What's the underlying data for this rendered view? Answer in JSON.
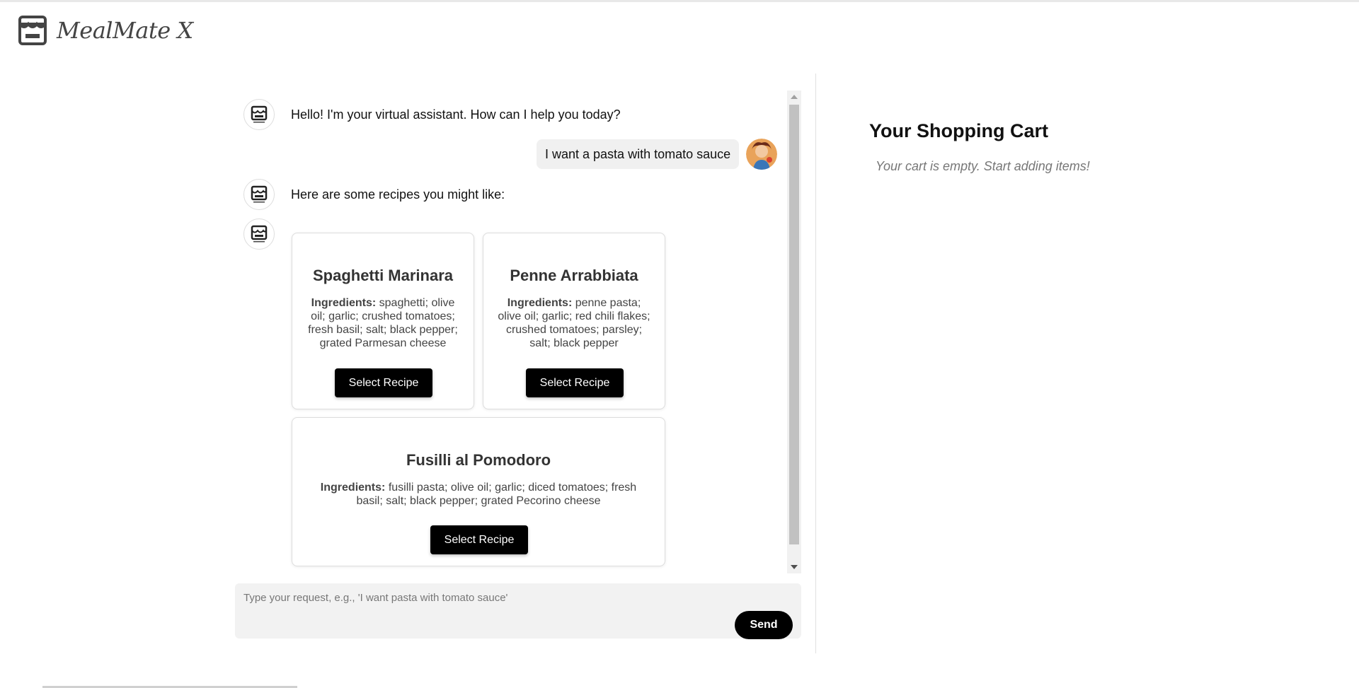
{
  "app": {
    "brand_name": "MealMate X",
    "logo_icon": "storefront-icon"
  },
  "chat": {
    "messages": [
      {
        "from": "bot",
        "text": "Hello! I'm your virtual assistant. How can I help you today?"
      },
      {
        "from": "user",
        "text": "I want a pasta with tomato sauce"
      },
      {
        "from": "bot",
        "text": "Here are some recipes you might like:"
      }
    ],
    "recipes": [
      {
        "title": "Spaghetti Marinara",
        "ingredients_label": "Ingredients:",
        "ingredients": "spaghetti; olive oil; garlic; crushed tomatoes; fresh basil; salt; black pepper; grated Parmesan cheese",
        "button_label": "Select Recipe"
      },
      {
        "title": "Penne Arrabbiata",
        "ingredients_label": "Ingredients:",
        "ingredients": "penne pasta; olive oil; garlic; red chili flakes; crushed tomatoes; parsley; salt; black pepper",
        "button_label": "Select Recipe"
      },
      {
        "title": "Fusilli al Pomodoro",
        "ingredients_label": "Ingredients:",
        "ingredients": "fusilli pasta; olive oil; garlic; diced tomatoes; fresh basil; salt; black pepper; grated Pecorino cheese",
        "button_label": "Select Recipe"
      }
    ]
  },
  "input": {
    "placeholder": "Type your request, e.g., 'I want pasta with tomato sauce'",
    "value": "",
    "send_label": "Send"
  },
  "cart": {
    "title": "Your Shopping Cart",
    "empty_message": "Your cart is empty. Start adding items!"
  },
  "colors": {
    "button_bg": "#000000",
    "button_text": "#ffffff",
    "bubble_bg": "#f0f0f0",
    "input_bg": "#f2f2f2"
  }
}
